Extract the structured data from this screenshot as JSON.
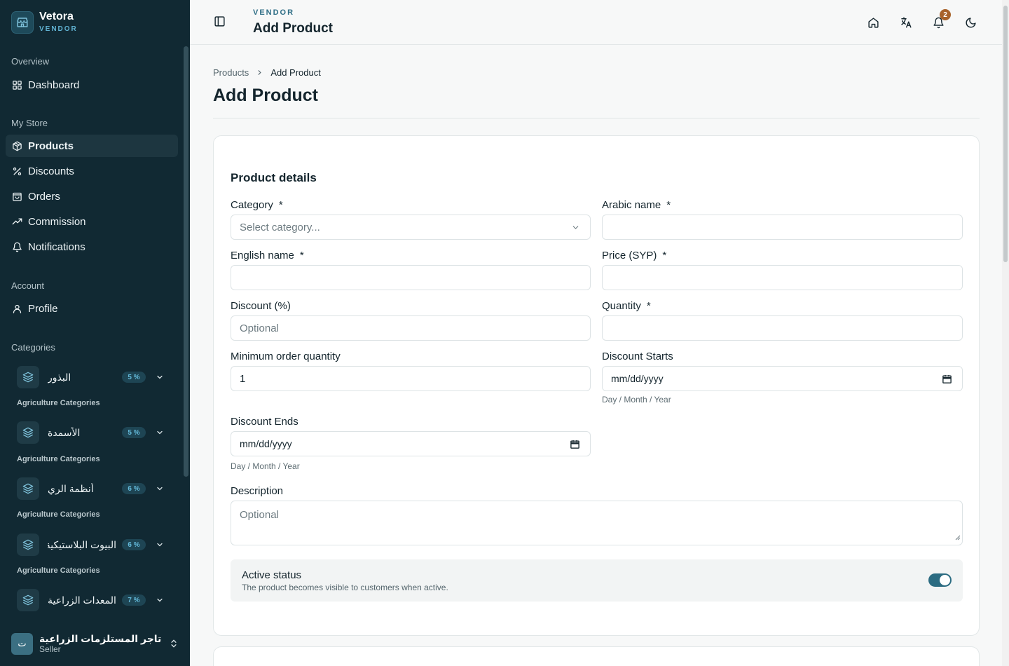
{
  "brand": {
    "name": "Vetora",
    "sub": "VENDOR"
  },
  "sidebar": {
    "overview_label": "Overview",
    "dashboard": "Dashboard",
    "mystore_label": "My Store",
    "store_items": [
      "Products",
      "Discounts",
      "Orders",
      "Commission",
      "Notifications"
    ],
    "account_label": "Account",
    "profile": "Profile",
    "categories_label": "Categories",
    "categories": [
      {
        "name": "البذور",
        "badge": "5 %",
        "group": "Agriculture Categories"
      },
      {
        "name": "الأسمدة",
        "badge": "5 %",
        "group": "Agriculture Categories"
      },
      {
        "name": "أنظمة الري",
        "badge": "6 %",
        "group": "Agriculture Categories"
      },
      {
        "name": "البيوت البلاستيكية",
        "badge": "6 %",
        "group": "Agriculture Categories"
      },
      {
        "name": "المعدات الزراعية",
        "badge": "7 %"
      }
    ],
    "user": {
      "initial": "ت",
      "name": "تاجر المستلزمات الزراعية",
      "role": "Seller"
    }
  },
  "topbar": {
    "kicker": "VENDOR",
    "title": "Add Product",
    "notification_count": "2"
  },
  "breadcrumb": {
    "parent": "Products",
    "current": "Add Product"
  },
  "page_title": "Add Product",
  "form": {
    "section_title": "Product details",
    "required_mark": "*",
    "category": {
      "label": "Category",
      "placeholder": "Select category..."
    },
    "arabic_name": {
      "label": "Arabic name",
      "value": ""
    },
    "english_name": {
      "label": "English name",
      "value": ""
    },
    "price": {
      "label": "Price (SYP)",
      "value": ""
    },
    "discount": {
      "label": "Discount (%)",
      "placeholder": "Optional"
    },
    "quantity": {
      "label": "Quantity",
      "value": ""
    },
    "min_qty": {
      "label": "Minimum order quantity",
      "value": "1"
    },
    "discount_starts": {
      "label": "Discount Starts",
      "placeholder": "mm/dd/yyyy",
      "hint": "Day / Month / Year"
    },
    "discount_ends": {
      "label": "Discount Ends",
      "placeholder": "mm/dd/yyyy",
      "hint": "Day / Month / Year"
    },
    "description": {
      "label": "Description",
      "placeholder": "Optional"
    },
    "active": {
      "title": "Active status",
      "desc": "The product becomes visible to customers when active.",
      "value": true
    }
  },
  "colors": {
    "sidebar_bg": "#112933",
    "accent": "#2c6c82",
    "badge": "#a8622b"
  },
  "icons": [
    "store-icon",
    "grid-icon",
    "box-icon",
    "percent-icon",
    "bag-icon",
    "trend-icon",
    "bell-icon",
    "user-icon",
    "layers-icon",
    "chevron-down-icon",
    "chevrons-updown-icon",
    "panel-toggle-icon",
    "home-icon",
    "translate-icon",
    "moon-icon",
    "calendar-icon",
    "chevron-right-icon"
  ]
}
